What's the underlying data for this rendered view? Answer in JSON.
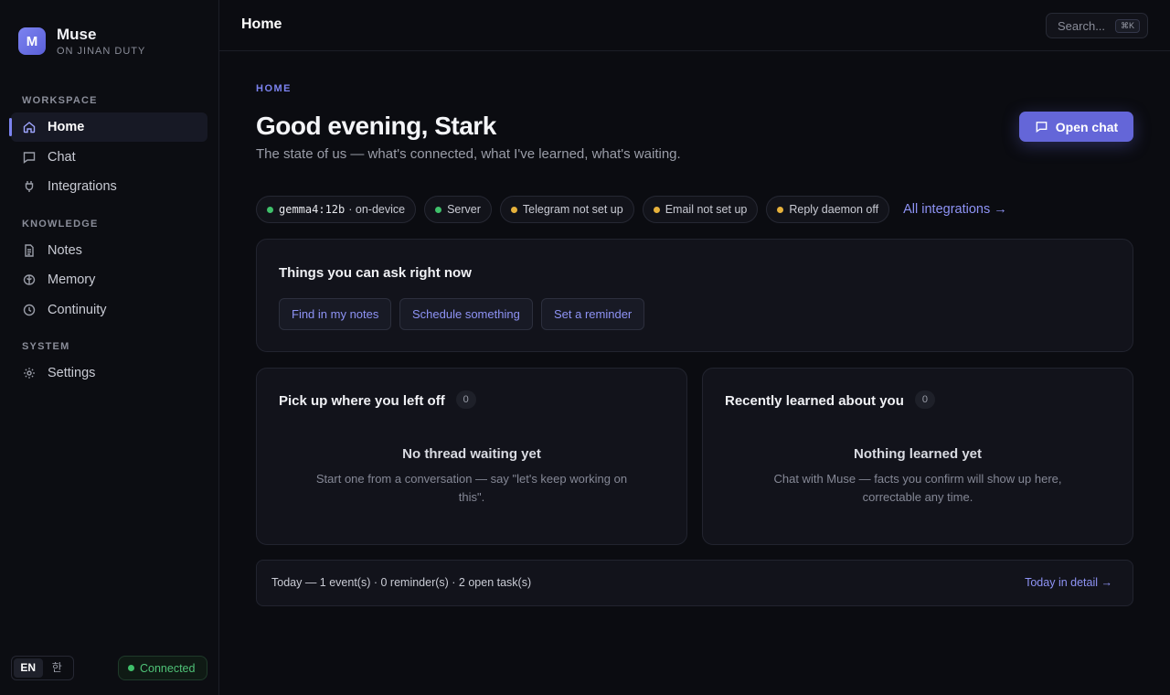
{
  "brand": {
    "initial": "M",
    "name": "Muse",
    "subtitle": "ON JINAN DUTY"
  },
  "sidebar": {
    "sections": [
      {
        "label": "WORKSPACE"
      },
      {
        "label": "KNOWLEDGE"
      },
      {
        "label": "SYSTEM"
      }
    ],
    "items": [
      {
        "label": "Home",
        "icon": "home-icon",
        "active": true
      },
      {
        "label": "Chat",
        "icon": "chat-bubble-icon"
      },
      {
        "label": "Integrations",
        "icon": "plug-icon"
      },
      {
        "label": "Notes",
        "icon": "document-icon"
      },
      {
        "label": "Memory",
        "icon": "brain-icon"
      },
      {
        "label": "Continuity",
        "icon": "clock-icon"
      },
      {
        "label": "Settings",
        "icon": "gear-icon"
      }
    ],
    "languages": [
      "EN",
      "한"
    ],
    "status": "Connected"
  },
  "topbar": {
    "title": "Home",
    "search_placeholder": "Search...",
    "shortcut": "⌘K"
  },
  "hero": {
    "eyebrow": "HOME",
    "greeting": "Good evening, Stark",
    "subline": "The state of us — what's connected, what I've learned, what's waiting.",
    "open_chat": "Open chat"
  },
  "status_chips": [
    {
      "mono": "gemma4:12b",
      "label": "· on-device",
      "color": "#3fc06a"
    },
    {
      "label": "Server",
      "color": "#3fc06a"
    },
    {
      "label": "Telegram not set up",
      "color": "#e6b13b"
    },
    {
      "label": "Email not set up",
      "color": "#e6b13b"
    },
    {
      "label": "Reply daemon off",
      "color": "#e6b13b"
    }
  ],
  "all_integrations": "All integrations →",
  "ask": {
    "title": "Things you can ask right now",
    "buttons": [
      "Find in my notes",
      "Schedule something",
      "Set a reminder"
    ]
  },
  "pickup": {
    "title": "Pick up where you left off",
    "count": "0",
    "empty_title": "No thread waiting yet",
    "empty_desc": "Start one from a conversation — say \"let's keep working on this\"."
  },
  "learned": {
    "title": "Recently learned about you",
    "count": "0",
    "empty_title": "Nothing learned yet",
    "empty_desc": "Chat with Muse — facts you confirm will show up here, correctable any time."
  },
  "today": {
    "summary": "Today — 1 event(s) · 0 reminder(s) · 2 open task(s)",
    "link": "Today in detail →"
  },
  "colors": {
    "accent": "#7c83f0",
    "button": "#6466d8",
    "ok": "#3fc06a",
    "warn": "#e6b13b"
  }
}
